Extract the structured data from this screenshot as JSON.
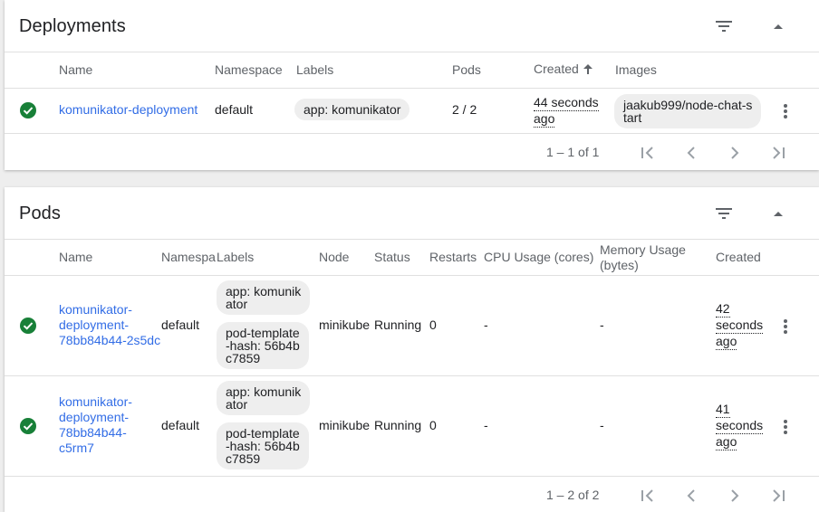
{
  "deployments": {
    "title": "Deployments",
    "columns": {
      "name": "Name",
      "namespace": "Namespace",
      "labels": "Labels",
      "pods": "Pods",
      "created": "Created",
      "images": "Images"
    },
    "rows": [
      {
        "name": "komunikator-deployment",
        "namespace": "default",
        "label": "app: komunikator",
        "pods": "2 / 2",
        "created_1": "44 seconds",
        "created_2": "ago",
        "image_1": "jaakub999/node-chat-s",
        "image_2": "tart"
      }
    ],
    "pagination": "1 – 1 of 1"
  },
  "pods": {
    "title": "Pods",
    "columns": {
      "name": "Name",
      "namespace": "Namespa",
      "labels": "Labels",
      "node": "Node",
      "status": "Status",
      "restarts": "Restarts",
      "cpu": "CPU Usage (cores)",
      "memory_1": "Memory Usage",
      "memory_2": "(bytes)",
      "created": "Created"
    },
    "rows": [
      {
        "name_1": "komunikator-",
        "name_2": "deployment-",
        "name_3": "78bb84b44-2s5dc",
        "namespace": "default",
        "label_a_1": "app: komunik",
        "label_a_2": "ator",
        "label_b_1": "pod-template",
        "label_b_2": "-hash: 56b4b",
        "label_b_3": "c7859",
        "node": "minikube",
        "status": "Running",
        "restarts": "0",
        "cpu": "-",
        "memory": "-",
        "created_1": "42",
        "created_2": "seconds",
        "created_3": "ago"
      },
      {
        "name_1": "komunikator-",
        "name_2": "deployment-",
        "name_3": "78bb84b44-",
        "name_4": "c5rm7",
        "namespace": "default",
        "label_a_1": "app: komunik",
        "label_a_2": "ator",
        "label_b_1": "pod-template",
        "label_b_2": "-hash: 56b4b",
        "label_b_3": "c7859",
        "node": "minikube",
        "status": "Running",
        "restarts": "0",
        "cpu": "-",
        "memory": "-",
        "created_1": "41",
        "created_2": "seconds",
        "created_3": "ago"
      }
    ],
    "pagination": "1 – 2 of 2"
  },
  "colors": {
    "link": "#326de6",
    "success": "#188038",
    "chip": "#eeeeee",
    "muted": "#5f6368"
  },
  "icons": [
    "filter-icon",
    "collapse-icon",
    "success-icon",
    "more-vert-icon",
    "first-page-icon",
    "prev-page-icon",
    "next-page-icon",
    "last-page-icon",
    "sort-up-icon"
  ]
}
